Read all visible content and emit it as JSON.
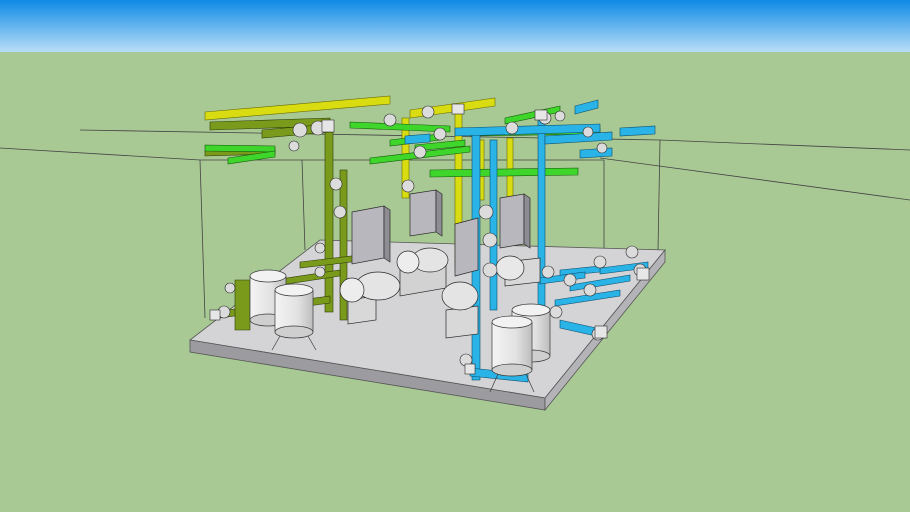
{
  "scene": {
    "description_label": "",
    "colors": {
      "sky_top": "#0e8ae6",
      "sky_bottom": "#b9def7",
      "ground": "#a8c894",
      "slab_top": "#d4d4d6",
      "slab_side": "#9c9ca0",
      "pipe_olive": "#7a9a1c",
      "pipe_yellow": "#d9dc10",
      "pipe_green": "#3fd62c",
      "pipe_cyan": "#2ab3e6",
      "tank": "#e6e6e6",
      "panel": "#b7b7bd",
      "valve": "#dcdcdc",
      "edge": "#2a2a2a"
    },
    "icons": [
      "pump-unit",
      "tank",
      "control-panel",
      "valve",
      "pipe-elbow"
    ]
  }
}
